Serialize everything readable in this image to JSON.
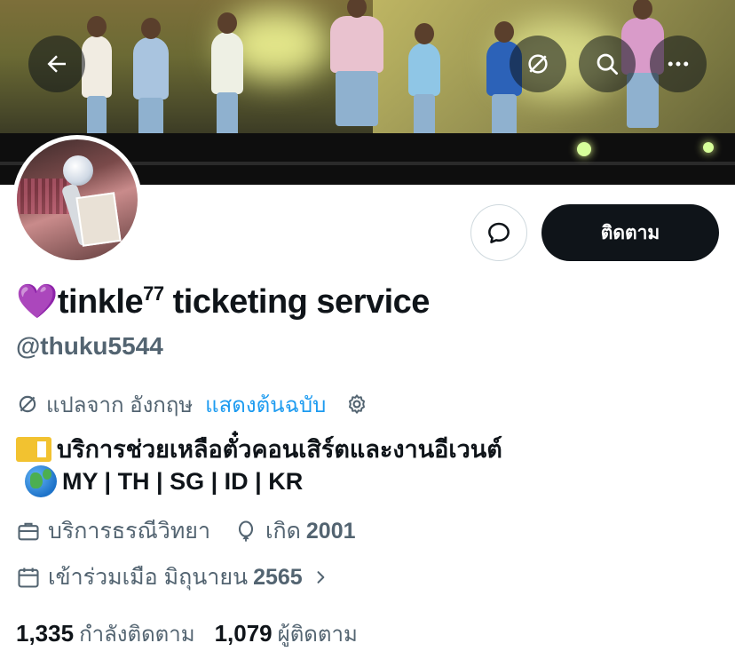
{
  "header": {
    "back_icon": "arrow-left-icon",
    "translate_icon": "translate-off-icon",
    "search_icon": "search-icon",
    "more_icon": "more-horizontal-icon"
  },
  "actions": {
    "message_icon": "message-bubble-icon",
    "follow_label": "ติดตาม"
  },
  "profile": {
    "emoji": "💜",
    "name_main": "tinkle",
    "name_sup": "77",
    "name_rest": " ticketing service",
    "handle": "@thuku5544"
  },
  "translation": {
    "translated_from": "แปลจาก อังกฤษ",
    "show_original": "แสดงต้นฉบับ"
  },
  "bio": {
    "line1": "บริการช่วยเหลือตั๋วคอนเสิร์ตและงานอีเวนต์",
    "line2": "MY | TH | SG | ID | KR"
  },
  "meta": {
    "category": "บริการธรณีวิทยา",
    "born_label": "เกิด",
    "born_year": "2001",
    "joined_label": "เข้าร่วมเมือ มิถุนายน",
    "joined_year": "2565"
  },
  "stats": {
    "following_count": "1,335",
    "following_label": "กำลังติดตาม",
    "followers_count": "1,079",
    "followers_label": "ผู้ติดตาม"
  },
  "colors": {
    "accent": "#1d9bf0",
    "text_primary": "#0f1419",
    "text_secondary": "#536471",
    "button_dark": "#0f1419"
  }
}
